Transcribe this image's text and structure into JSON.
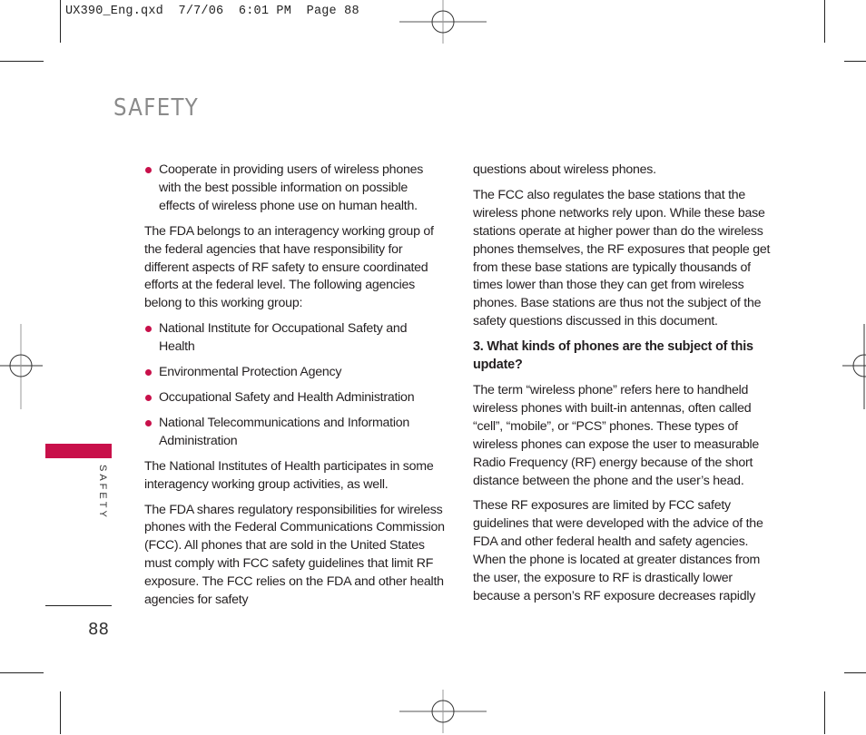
{
  "slug": "UX390_Eng.qxd  7/7/06  6:01 PM  Page 88",
  "section_title": "SAFETY",
  "side_tab_label": "SAFETY",
  "page_number": "88",
  "accent_color": "#c8104a",
  "left_column": {
    "bullet_1": "Cooperate in providing users of wireless phones with the best possible information on possible effects of wireless phone use on human health.",
    "para_1": "The FDA belongs to an interagency working group of the federal agencies that have responsibility for different aspects of RF safety to ensure coordinated efforts at the federal level. The following agencies belong to this working group:",
    "agencies": [
      "National Institute for Occupational Safety and Health",
      "Environmental Protection Agency",
      "Occupational Safety and Health Administration",
      "National Telecommunications and Information Administration"
    ],
    "para_2": "The National Institutes of Health participates in some interagency working group activities, as well.",
    "para_3": "The FDA shares regulatory responsibilities for wireless phones with the Federal Communications Commission (FCC). All phones that are sold in the United States must comply with FCC safety guidelines that limit RF exposure. The FCC relies on the FDA and other health agencies for safety"
  },
  "right_column": {
    "para_1": "questions about wireless phones.",
    "para_2": "The FCC also regulates the base stations that the wireless phone networks rely upon. While these base stations operate at higher power than do the wireless phones themselves, the RF exposures that people get from these base stations are typically thousands of times lower than those they can get from wireless phones. Base stations are thus not the subject of the safety questions discussed in this document.",
    "heading": "3. What kinds of phones are the subject of this update?",
    "para_3": "The term “wireless phone” refers here to handheld wireless phones with built-in antennas, often called “cell”, “mobile”, or “PCS” phones. These types of wireless phones can expose the user to measurable Radio Frequency (RF) energy because of the short distance between the phone and the user’s head.",
    "para_4": "These RF exposures are limited by FCC safety guidelines that were developed with the advice of the FDA and other federal health and safety agencies. When the phone is located at greater distances from the user, the exposure to RF is drastically lower because a person’s RF exposure decreases rapidly"
  }
}
